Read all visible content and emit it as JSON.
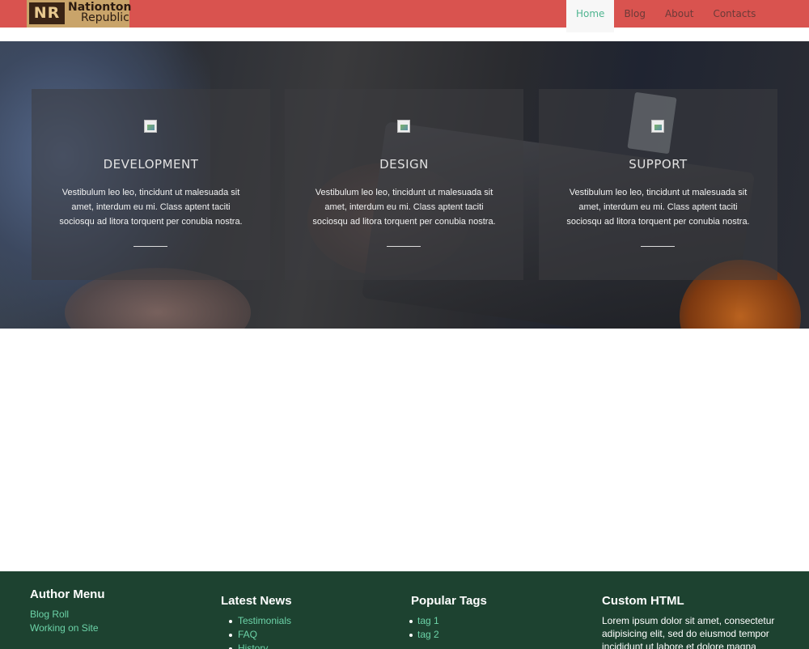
{
  "header": {
    "logo": {
      "mark": "NR",
      "line1": "Nationton",
      "line2": "Republic"
    },
    "nav": [
      {
        "label": "Home",
        "active": true
      },
      {
        "label": "Blog",
        "active": false
      },
      {
        "label": "About",
        "active": false
      },
      {
        "label": "Contacts",
        "active": false
      }
    ]
  },
  "features": [
    {
      "title": "DEVELOPMENT",
      "text": "Vestibulum leo leo, tincidunt ut malesuada sit amet, interdum eu mi. Class aptent taciti sociosqu ad litora torquent per conubia nostra."
    },
    {
      "title": "DESIGN",
      "text": "Vestibulum leo leo, tincidunt ut malesuada sit amet, interdum eu mi. Class aptent taciti sociosqu ad litora torquent per conubia nostra."
    },
    {
      "title": "SUPPORT",
      "text": "Vestibulum leo leo, tincidunt ut malesuada sit amet, interdum eu mi. Class aptent taciti sociosqu ad litora torquent per conubia nostra."
    }
  ],
  "footer": {
    "author_menu": {
      "title": "Author Menu",
      "links": [
        "Blog Roll",
        "Working on Site"
      ]
    },
    "latest_news": {
      "title": "Latest News",
      "items": [
        "Testimonials",
        "FAQ",
        "History"
      ]
    },
    "popular_tags": {
      "title": "Popular Tags",
      "items": [
        "tag 1",
        "tag 2"
      ]
    },
    "custom_html": {
      "title": "Custom HTML",
      "text": "Lorem ipsum dolor sit amet, consectetur adipisicing elit, sed do eiusmod tempor incididunt ut labore et dolore magna"
    }
  },
  "colors": {
    "header_bg": "#d9534f",
    "nav_active": "#4fb590",
    "footer_bg": "#1d4230",
    "footer_link": "#6cd3a8"
  }
}
